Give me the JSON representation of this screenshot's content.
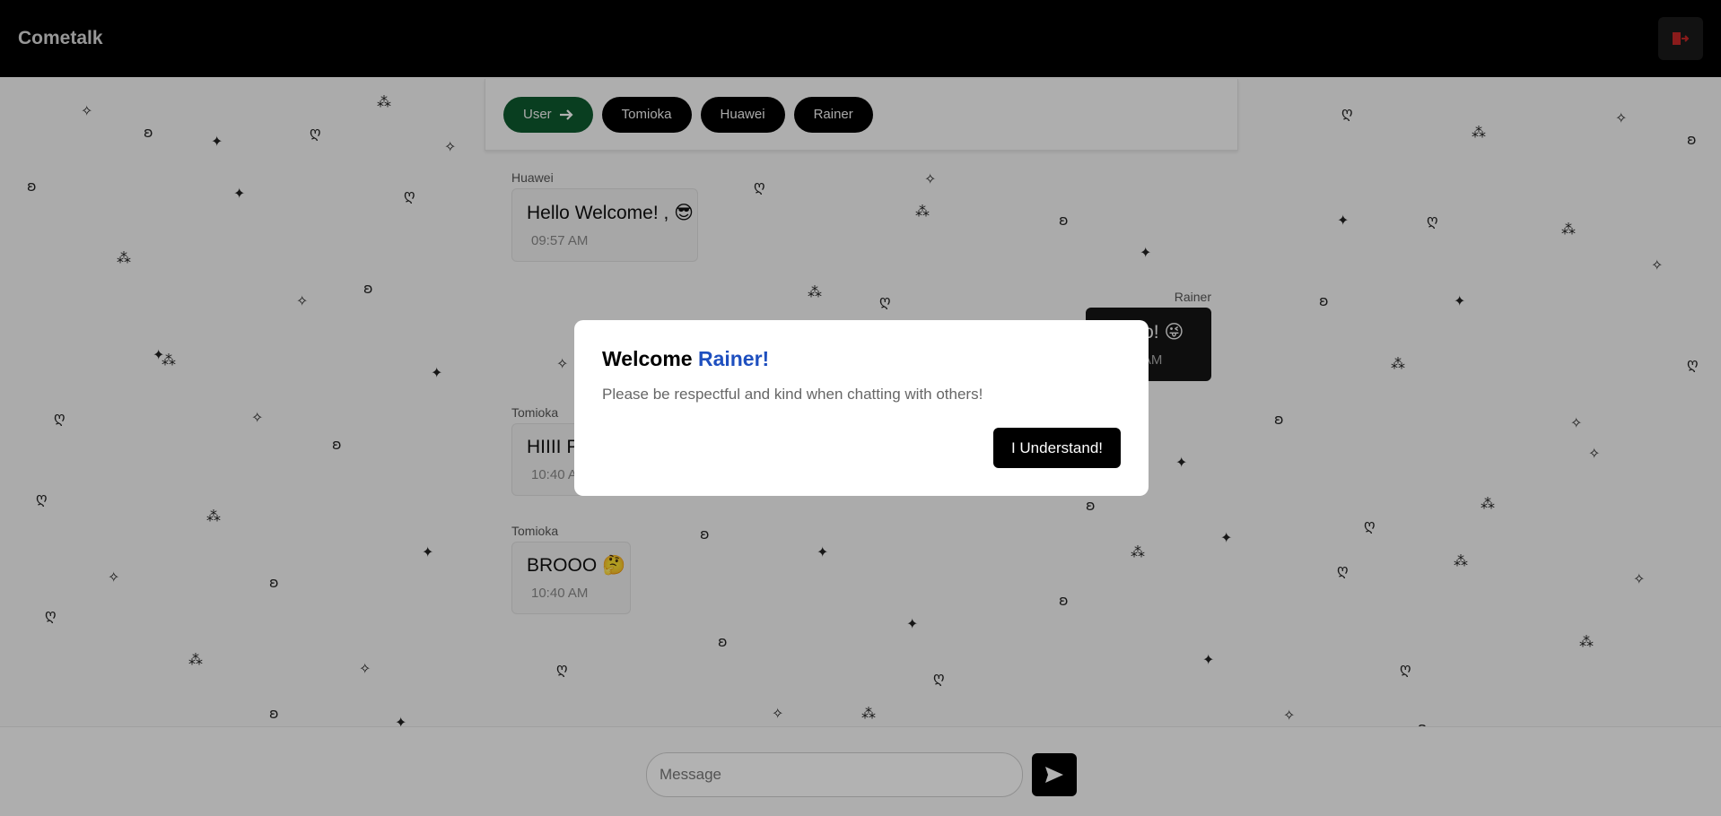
{
  "header": {
    "brand": "Cometalk",
    "leave_icon": "logout-icon",
    "leave_icon_color": "#c62828"
  },
  "tabs": [
    {
      "label": "User",
      "icon": "arrow-right-icon",
      "active": true
    },
    {
      "label": "Tomioka"
    },
    {
      "label": "Huawei"
    },
    {
      "label": "Rainer"
    }
  ],
  "messages": [
    {
      "sender": "Huawei",
      "text": "Hello Welcome! , 😎",
      "time": "09:57 AM",
      "side": "left"
    },
    {
      "sender": "Rainer",
      "text": "Yoooo! 😜",
      "time": "10:37 AM",
      "side": "right"
    },
    {
      "sender": "Tomioka",
      "text": "HIIII PPL",
      "time": "10:40 AM",
      "side": "left"
    },
    {
      "sender": "Tomioka",
      "text": "BROOO 🤔",
      "time": "10:40 AM",
      "side": "left"
    }
  ],
  "composer": {
    "placeholder": "Message",
    "send_icon": "send-icon"
  },
  "modal": {
    "title_prefix": "Welcome ",
    "title_name": "Rainer!",
    "body": "Please be respectful and kind when chatting with others!",
    "button": "I Understand!"
  },
  "colors": {
    "active_tab": "#0e5a2e",
    "accent_name": "#1e4fbf",
    "header_bg": "#000000"
  }
}
